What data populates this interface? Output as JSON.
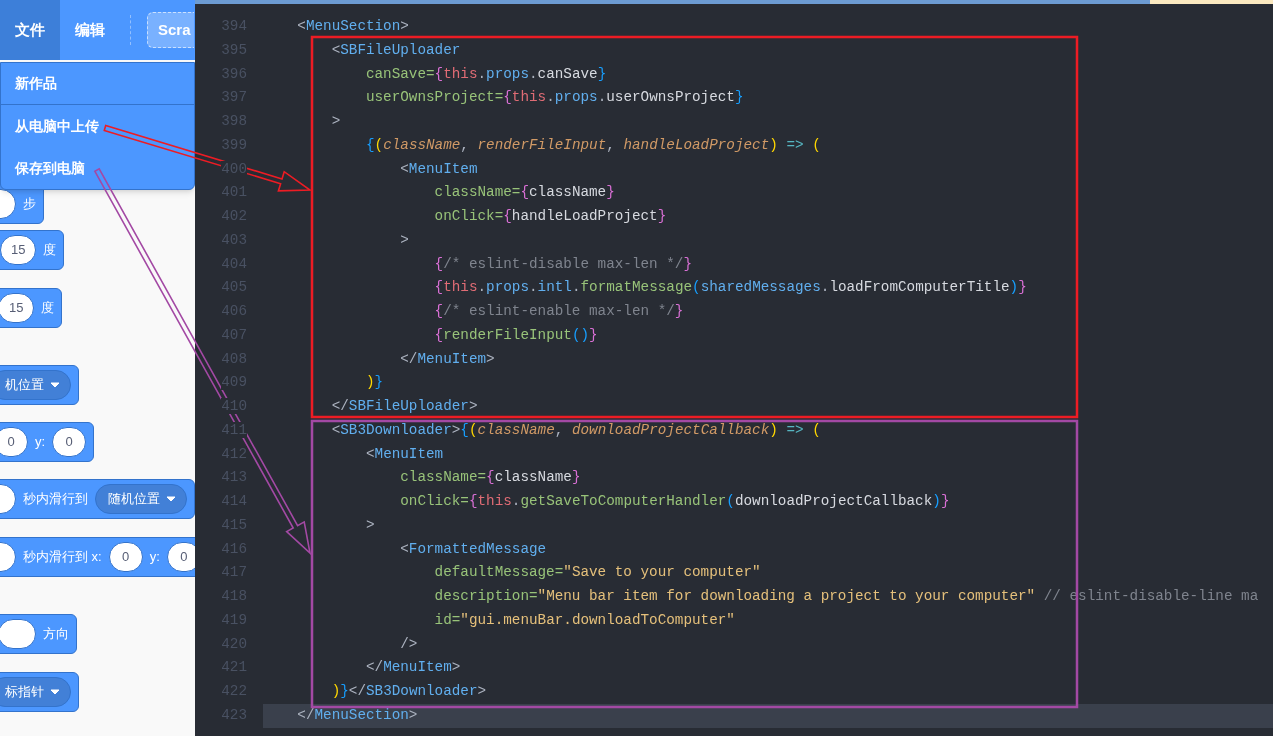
{
  "scratch": {
    "menu_bar": [
      {
        "label": "文件",
        "selected": true
      },
      {
        "label": "编辑",
        "selected": false
      }
    ],
    "project_title": "Scra",
    "file_menu": [
      {
        "label": "新作品",
        "separator": true
      },
      {
        "label": "从电脑中上传",
        "separator": false
      },
      {
        "label": "保存到电脑",
        "separator": false
      }
    ],
    "blocks": [
      {
        "parts": [
          {
            "kind": "blank"
          },
          {
            "kind": "text",
            "text": "步"
          }
        ]
      },
      {
        "parts": [
          {
            "kind": "number",
            "text": "15"
          },
          {
            "kind": "text",
            "text": "度"
          }
        ]
      },
      {
        "parts": [
          {
            "kind": "number",
            "text": "15"
          },
          {
            "kind": "text",
            "text": "度"
          }
        ]
      },
      {
        "parts": [
          {
            "kind": "dropdown",
            "text": "机位置"
          }
        ]
      },
      {
        "parts": [
          {
            "kind": "number",
            "text": "0"
          },
          {
            "kind": "text",
            "text": "y:"
          },
          {
            "kind": "number",
            "text": "0"
          }
        ]
      },
      {
        "parts": [
          {
            "kind": "blank"
          },
          {
            "kind": "text",
            "text": "秒内滑行到"
          },
          {
            "kind": "dropdown",
            "text": "随机位置"
          }
        ]
      },
      {
        "parts": [
          {
            "kind": "blank"
          },
          {
            "kind": "text",
            "text": "秒内滑行到 x:"
          },
          {
            "kind": "number",
            "text": "0"
          },
          {
            "kind": "text",
            "text": "y:"
          },
          {
            "kind": "number",
            "text": "0"
          }
        ]
      },
      {
        "parts": [
          {
            "kind": "blank"
          },
          {
            "kind": "text",
            "text": "方向"
          }
        ]
      },
      {
        "parts": [
          {
            "kind": "dropdown",
            "text": "标指针"
          }
        ]
      }
    ]
  },
  "editor": {
    "lines": [
      {
        "number": "394",
        "current": false,
        "tokens": [
          {
            "kind": "punct",
            "text": "    <"
          },
          {
            "kind": "tag",
            "text": "MenuSection"
          },
          {
            "kind": "punct",
            "text": ">"
          }
        ]
      },
      {
        "number": "395",
        "current": false,
        "tokens": [
          {
            "kind": "punct",
            "text": "        <"
          },
          {
            "kind": "tag",
            "text": "SBFileUploader"
          }
        ]
      },
      {
        "number": "396",
        "current": false,
        "tokens": [
          {
            "kind": "attr",
            "text": "            canSave="
          },
          {
            "kind": "bracket2",
            "text": "{"
          },
          {
            "kind": "keyword",
            "text": "this"
          },
          {
            "kind": "punct",
            "text": "."
          },
          {
            "kind": "prop",
            "text": "props"
          },
          {
            "kind": "punct",
            "text": "."
          },
          {
            "kind": "plain",
            "text": "canSave"
          },
          {
            "kind": "bracket3",
            "text": "}"
          }
        ]
      },
      {
        "number": "397",
        "current": false,
        "tokens": [
          {
            "kind": "attr",
            "text": "            userOwnsProject="
          },
          {
            "kind": "bracket2",
            "text": "{"
          },
          {
            "kind": "keyword",
            "text": "this"
          },
          {
            "kind": "punct",
            "text": "."
          },
          {
            "kind": "prop",
            "text": "props"
          },
          {
            "kind": "punct",
            "text": "."
          },
          {
            "kind": "plain",
            "text": "userOwnsProject"
          },
          {
            "kind": "bracket3",
            "text": "}"
          }
        ]
      },
      {
        "number": "398",
        "current": false,
        "tokens": [
          {
            "kind": "punct",
            "text": "        >"
          }
        ]
      },
      {
        "number": "399",
        "current": false,
        "tokens": [
          {
            "kind": "bracket3",
            "text": "            {"
          },
          {
            "kind": "bracket1",
            "text": "("
          },
          {
            "kind": "param",
            "text": "className"
          },
          {
            "kind": "punct",
            "text": ", "
          },
          {
            "kind": "param",
            "text": "renderFileInput"
          },
          {
            "kind": "punct",
            "text": ", "
          },
          {
            "kind": "param",
            "text": "handleLoadProject"
          },
          {
            "kind": "bracket1",
            "text": ")"
          },
          {
            "kind": "arrow",
            "text": " => "
          },
          {
            "kind": "bracket1",
            "text": "("
          }
        ]
      },
      {
        "number": "400",
        "current": false,
        "tokens": [
          {
            "kind": "punct",
            "text": "                <"
          },
          {
            "kind": "tag",
            "text": "MenuItem"
          }
        ]
      },
      {
        "number": "401",
        "current": false,
        "tokens": [
          {
            "kind": "attr",
            "text": "                    className="
          },
          {
            "kind": "bracket2",
            "text": "{"
          },
          {
            "kind": "plain",
            "text": "className"
          },
          {
            "kind": "bracket2",
            "text": "}"
          }
        ]
      },
      {
        "number": "402",
        "current": false,
        "tokens": [
          {
            "kind": "attr",
            "text": "                    onClick="
          },
          {
            "kind": "bracket2",
            "text": "{"
          },
          {
            "kind": "plain",
            "text": "handleLoadProject"
          },
          {
            "kind": "bracket2",
            "text": "}"
          }
        ]
      },
      {
        "number": "403",
        "current": false,
        "tokens": [
          {
            "kind": "punct",
            "text": "                >"
          }
        ]
      },
      {
        "number": "404",
        "current": false,
        "tokens": [
          {
            "kind": "bracket2",
            "text": "                    {"
          },
          {
            "kind": "comment",
            "text": "/* eslint-disable max-len */"
          },
          {
            "kind": "bracket2",
            "text": "}"
          }
        ]
      },
      {
        "number": "405",
        "current": false,
        "tokens": [
          {
            "kind": "bracket2",
            "text": "                    {"
          },
          {
            "kind": "keyword",
            "text": "this"
          },
          {
            "kind": "punct",
            "text": "."
          },
          {
            "kind": "prop",
            "text": "props"
          },
          {
            "kind": "punct",
            "text": "."
          },
          {
            "kind": "prop",
            "text": "intl"
          },
          {
            "kind": "punct",
            "text": "."
          },
          {
            "kind": "func",
            "text": "formatMessage"
          },
          {
            "kind": "bracket3",
            "text": "("
          },
          {
            "kind": "prop",
            "text": "sharedMessages"
          },
          {
            "kind": "punct",
            "text": "."
          },
          {
            "kind": "plain",
            "text": "loadFromComputerTitle"
          },
          {
            "kind": "bracket3",
            "text": ")"
          },
          {
            "kind": "bracket2",
            "text": "}"
          }
        ]
      },
      {
        "number": "406",
        "current": false,
        "tokens": [
          {
            "kind": "bracket2",
            "text": "                    {"
          },
          {
            "kind": "comment",
            "text": "/* eslint-enable max-len */"
          },
          {
            "kind": "bracket2",
            "text": "}"
          }
        ]
      },
      {
        "number": "407",
        "current": false,
        "tokens": [
          {
            "kind": "bracket2",
            "text": "                    {"
          },
          {
            "kind": "func",
            "text": "renderFileInput"
          },
          {
            "kind": "bracket3",
            "text": "()"
          },
          {
            "kind": "bracket2",
            "text": "}"
          }
        ]
      },
      {
        "number": "408",
        "current": false,
        "tokens": [
          {
            "kind": "punct",
            "text": "                </"
          },
          {
            "kind": "tag",
            "text": "MenuItem"
          },
          {
            "kind": "punct",
            "text": ">"
          }
        ]
      },
      {
        "number": "409",
        "current": false,
        "tokens": [
          {
            "kind": "bracket1",
            "text": "            )"
          },
          {
            "kind": "bracket3",
            "text": "}"
          }
        ]
      },
      {
        "number": "410",
        "current": false,
        "tokens": [
          {
            "kind": "punct",
            "text": "        </"
          },
          {
            "kind": "tag",
            "text": "SBFileUploader"
          },
          {
            "kind": "punct",
            "text": ">"
          }
        ]
      },
      {
        "number": "411",
        "current": false,
        "tokens": [
          {
            "kind": "punct",
            "text": "        <"
          },
          {
            "kind": "tag",
            "text": "SB3Downloader"
          },
          {
            "kind": "punct",
            "text": ">"
          },
          {
            "kind": "bracket3",
            "text": "{"
          },
          {
            "kind": "bracket1",
            "text": "("
          },
          {
            "kind": "param",
            "text": "className"
          },
          {
            "kind": "punct",
            "text": ", "
          },
          {
            "kind": "param",
            "text": "downloadProjectCallback"
          },
          {
            "kind": "bracket1",
            "text": ")"
          },
          {
            "kind": "arrow",
            "text": " => "
          },
          {
            "kind": "bracket1",
            "text": "("
          }
        ]
      },
      {
        "number": "412",
        "current": false,
        "tokens": [
          {
            "kind": "punct",
            "text": "            <"
          },
          {
            "kind": "tag",
            "text": "MenuItem"
          }
        ]
      },
      {
        "number": "413",
        "current": false,
        "tokens": [
          {
            "kind": "attr",
            "text": "                className="
          },
          {
            "kind": "bracket2",
            "text": "{"
          },
          {
            "kind": "plain",
            "text": "className"
          },
          {
            "kind": "bracket2",
            "text": "}"
          }
        ]
      },
      {
        "number": "414",
        "current": false,
        "tokens": [
          {
            "kind": "attr",
            "text": "                onClick="
          },
          {
            "kind": "bracket2",
            "text": "{"
          },
          {
            "kind": "keyword",
            "text": "this"
          },
          {
            "kind": "punct",
            "text": "."
          },
          {
            "kind": "func",
            "text": "getSaveToComputerHandler"
          },
          {
            "kind": "bracket3",
            "text": "("
          },
          {
            "kind": "plain",
            "text": "downloadProjectCallback"
          },
          {
            "kind": "bracket3",
            "text": ")"
          },
          {
            "kind": "bracket2",
            "text": "}"
          }
        ]
      },
      {
        "number": "415",
        "current": false,
        "tokens": [
          {
            "kind": "punct",
            "text": "            >"
          }
        ]
      },
      {
        "number": "416",
        "current": false,
        "tokens": [
          {
            "kind": "punct",
            "text": "                <"
          },
          {
            "kind": "tag",
            "text": "FormattedMessage"
          }
        ]
      },
      {
        "number": "417",
        "current": false,
        "tokens": [
          {
            "kind": "attr",
            "text": "                    defaultMessage="
          },
          {
            "kind": "string",
            "text": "\"Save to your computer\""
          }
        ]
      },
      {
        "number": "418",
        "current": false,
        "tokens": [
          {
            "kind": "attr",
            "text": "                    description="
          },
          {
            "kind": "string",
            "text": "\"Menu bar item for downloading a project to your computer\""
          },
          {
            "kind": "comment",
            "text": " // eslint-disable-line ma"
          }
        ]
      },
      {
        "number": "419",
        "current": false,
        "tokens": [
          {
            "kind": "attr",
            "text": "                    id="
          },
          {
            "kind": "string",
            "text": "\"gui.menuBar.downloadToComputer\""
          }
        ]
      },
      {
        "number": "420",
        "current": false,
        "tokens": [
          {
            "kind": "punct",
            "text": "                />"
          }
        ]
      },
      {
        "number": "421",
        "current": false,
        "tokens": [
          {
            "kind": "punct",
            "text": "            </"
          },
          {
            "kind": "tag",
            "text": "MenuItem"
          },
          {
            "kind": "punct",
            "text": ">"
          }
        ]
      },
      {
        "number": "422",
        "current": false,
        "tokens": [
          {
            "kind": "bracket1",
            "text": "        )"
          },
          {
            "kind": "bracket3",
            "text": "}"
          },
          {
            "kind": "punct",
            "text": "</"
          },
          {
            "kind": "tag",
            "text": "SB3Downloader"
          },
          {
            "kind": "punct",
            "text": ">"
          }
        ]
      },
      {
        "number": "423",
        "current": true,
        "tokens": [
          {
            "kind": "punct",
            "text": "    </"
          },
          {
            "kind": "tag",
            "text": "MenuSection"
          },
          {
            "kind": "punct",
            "text": ">"
          }
        ]
      }
    ]
  },
  "frames": [
    {
      "color": "#ed1c24"
    },
    {
      "color": "#a349a4"
    }
  ],
  "arrows": [
    {
      "color": "#ed1c24"
    },
    {
      "color": "#a349a4"
    }
  ]
}
